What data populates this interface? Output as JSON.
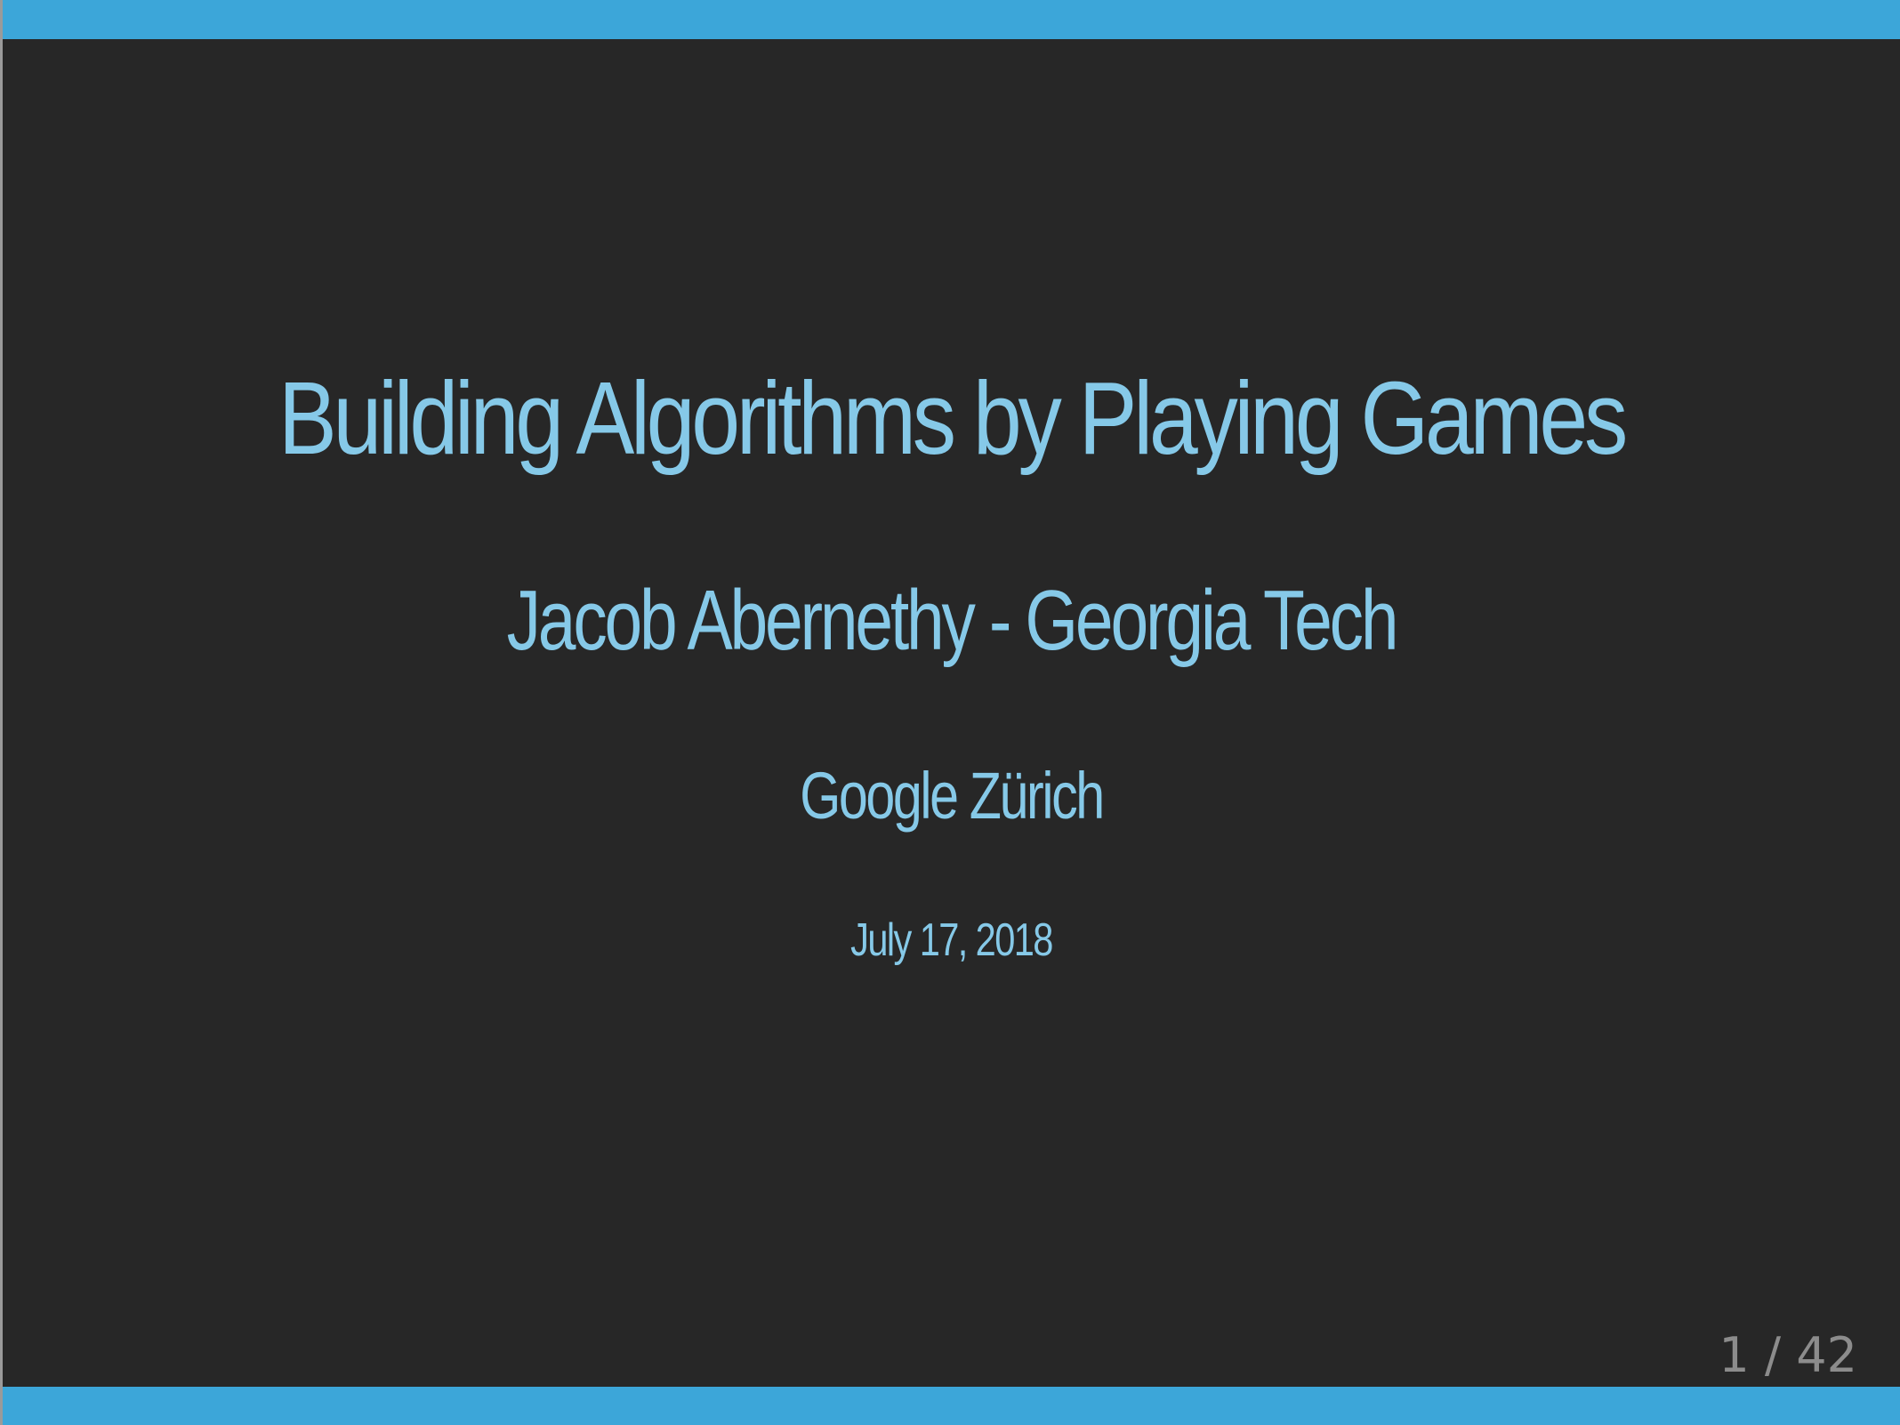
{
  "slide": {
    "title": "Building Algorithms by Playing Games",
    "author": "Jacob Abernethy - Georgia Tech",
    "venue": "Google Zürich",
    "date": "July 17, 2018"
  },
  "pagination": {
    "label": "1 / 42",
    "current": 1,
    "total": 42
  },
  "colors": {
    "background": "#272727",
    "accent_bar": "#3ca6d9",
    "text": "#86c9e8",
    "page_counter": "#8c8c8c"
  }
}
